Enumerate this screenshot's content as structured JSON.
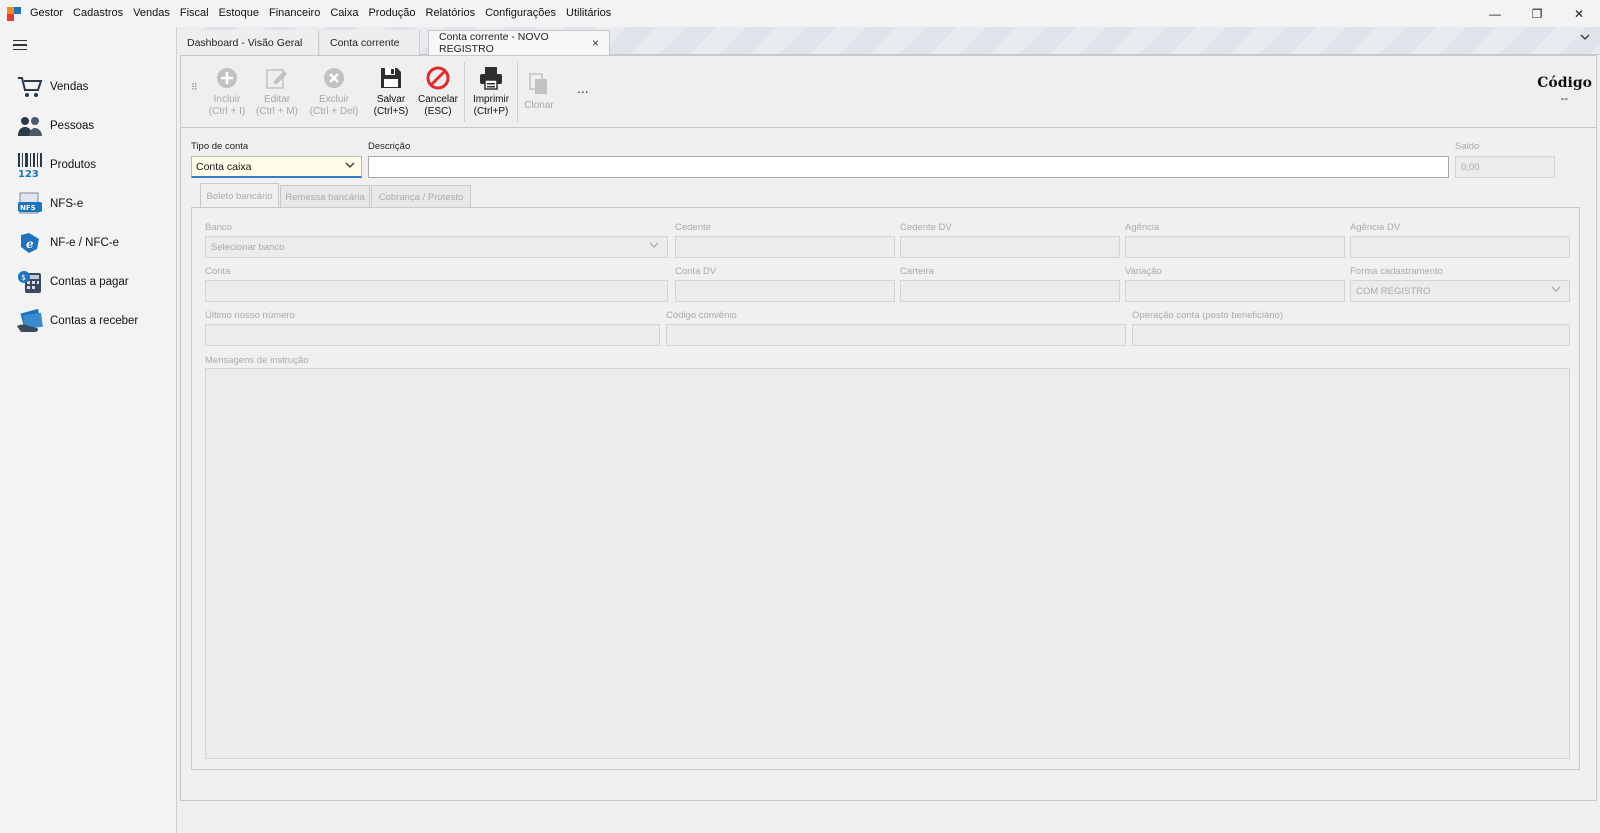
{
  "app": {
    "name": "Gestor",
    "menu": [
      "Cadastros",
      "Vendas",
      "Fiscal",
      "Estoque",
      "Financeiro",
      "Caixa",
      "Produção",
      "Relatórios",
      "Configurações",
      "Utilitários"
    ],
    "window_controls": {
      "minimize": "—",
      "restore": "❐",
      "close": "✕"
    }
  },
  "sidebar": {
    "items": [
      {
        "label": "Vendas",
        "icon": "cart-icon"
      },
      {
        "label": "Pessoas",
        "icon": "people-icon"
      },
      {
        "label": "Produtos",
        "icon": "barcode-icon"
      },
      {
        "label": "NFS-e",
        "icon": "nfse-icon"
      },
      {
        "label": "NF-e / NFC-e",
        "icon": "nfe-icon"
      },
      {
        "label": "Contas a pagar",
        "icon": "calculator-coin-icon"
      },
      {
        "label": "Contas a receber",
        "icon": "cash-receive-icon"
      }
    ]
  },
  "tabs": [
    {
      "label": "Dashboard - Visão Geral",
      "active": false
    },
    {
      "label": "Conta corrente",
      "active": false
    },
    {
      "label": "Conta corrente - NOVO REGISTRO",
      "active": true,
      "close": "×"
    }
  ],
  "toolbar": {
    "incluir": {
      "l1": "Incluir",
      "l2": "(Ctrl + I)"
    },
    "editar": {
      "l1": "Editar",
      "l2": "(Ctrl + M)"
    },
    "excluir": {
      "l1": "Excluir",
      "l2": "(Ctrl + Del)"
    },
    "salvar": {
      "l1": "Salvar",
      "l2": "(Ctrl+S)"
    },
    "cancelar": {
      "l1": "Cancelar",
      "l2": "(ESC)"
    },
    "imprimir": {
      "l1": "Imprimir",
      "l2": "(Ctrl+P)"
    },
    "clonar": {
      "l1": "Clonar"
    },
    "more": "...",
    "codigo_label": "Código",
    "codigo_value": "--"
  },
  "form": {
    "tipo_conta_label": "Tipo de conta",
    "tipo_conta_value": "Conta caixa",
    "descricao_label": "Descrição",
    "descricao_value": "",
    "saldo_label": "Saldo",
    "saldo_value": "0,00"
  },
  "inner_tabs": [
    "Boleto bancário",
    "Remessa bancária",
    "Cobrança / Protesto"
  ],
  "boleto": {
    "banco_label": "Banco",
    "banco_placeholder": "Selecionar banco",
    "cedente_label": "Cedente",
    "cedente_dv_label": "Cedente DV",
    "agencia_label": "Agência",
    "agencia_dv_label": "Agência DV",
    "conta_label": "Conta",
    "conta_dv_label": "Conta DV",
    "carteira_label": "Carteira",
    "variacao_label": "Variação",
    "forma_label": "Forma cadastramento",
    "forma_value": "COM REGISTRO",
    "ultimo_label": "Último nosso número",
    "codigo_convenio_label": "Código convênio",
    "operacao_label": "Operação conta (posto beneficiário)",
    "mensagens_label": "Mensagens de instrução"
  }
}
